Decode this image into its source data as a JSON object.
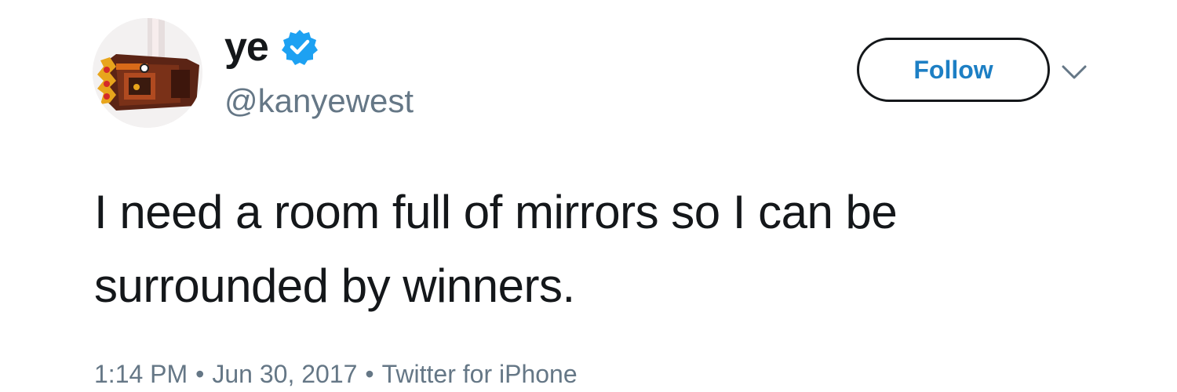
{
  "user": {
    "display_name": "ye",
    "handle": "@kanyewest",
    "verified": true,
    "avatar_icon": "avatar-icon"
  },
  "actions": {
    "follow_label": "Follow",
    "more_icon": "chevron-down-icon"
  },
  "tweet": {
    "text": "I need a room full of mirrors so I can be surrounded by winners.",
    "time": "1:14 PM",
    "date": "Jun 30, 2017",
    "source": "Twitter for iPhone",
    "separator": "•"
  },
  "colors": {
    "verified_blue": "#1da1f2",
    "follow_text": "#1d7fc4",
    "muted_text": "#657786",
    "primary_text": "#14171a"
  }
}
